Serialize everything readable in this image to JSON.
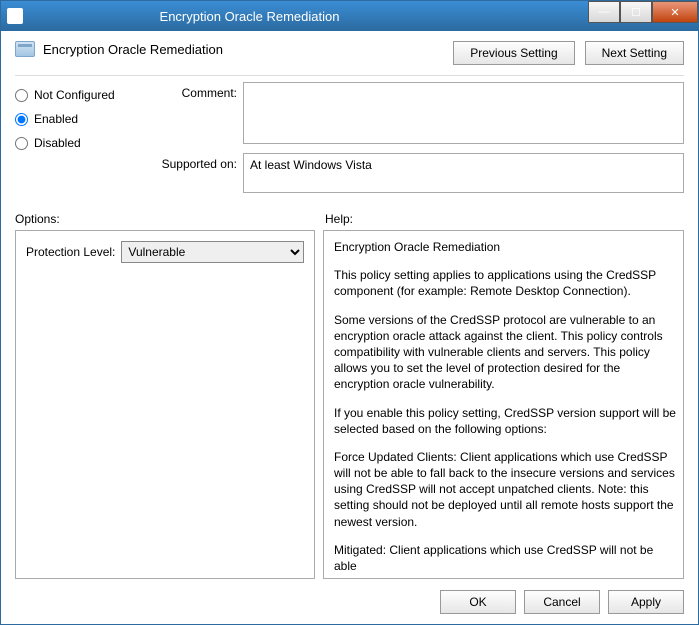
{
  "window": {
    "title": "Encryption Oracle Remediation"
  },
  "header": {
    "title": "Encryption Oracle Remediation",
    "previous_setting": "Previous Setting",
    "next_setting": "Next Setting"
  },
  "state": {
    "not_configured": "Not Configured",
    "enabled": "Enabled",
    "disabled": "Disabled",
    "selected": "enabled"
  },
  "comment": {
    "label": "Comment:",
    "value": ""
  },
  "supported": {
    "label": "Supported on:",
    "value": "At least Windows Vista"
  },
  "sections": {
    "options": "Options:",
    "help": "Help:"
  },
  "options": {
    "protection_label": "Protection Level:",
    "protection_value": "Vulnerable"
  },
  "help": {
    "p1": "Encryption Oracle Remediation",
    "p2": "This policy setting applies to applications using the CredSSP component (for example: Remote Desktop Connection).",
    "p3": "Some versions of the CredSSP protocol are vulnerable to an encryption oracle attack against the client.  This policy controls compatibility with vulnerable clients and servers.  This policy allows you to set the level of protection desired for the encryption oracle vulnerability.",
    "p4": "If you enable this policy setting, CredSSP version support will be selected based on the following options:",
    "p5": "Force Updated Clients: Client applications which use CredSSP will not be able to fall back to the insecure versions and services using CredSSP will not accept unpatched clients. Note: this setting should not be deployed until all remote hosts support the newest version.",
    "p6": "Mitigated: Client applications which use CredSSP will not be able"
  },
  "footer": {
    "ok": "OK",
    "cancel": "Cancel",
    "apply": "Apply"
  }
}
